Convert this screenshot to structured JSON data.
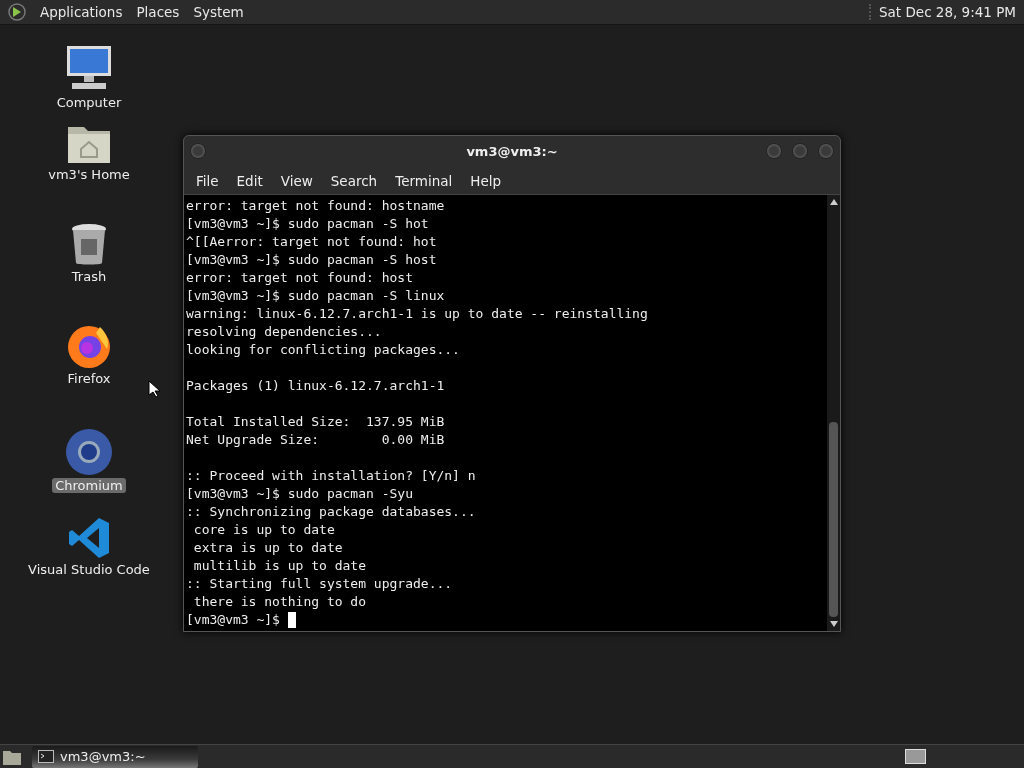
{
  "top_panel": {
    "menus": [
      "Applications",
      "Places",
      "System"
    ],
    "clock": "Sat Dec 28,  9:41 PM"
  },
  "desktop_icons": [
    {
      "kind": "computer",
      "label": "Computer",
      "selected": false
    },
    {
      "kind": "home",
      "label": "vm3's Home",
      "selected": false
    },
    {
      "kind": "trash",
      "label": "Trash",
      "selected": false
    },
    {
      "kind": "firefox",
      "label": "Firefox",
      "selected": false
    },
    {
      "kind": "chromium",
      "label": "Chromium",
      "selected": true
    },
    {
      "kind": "vscode",
      "label": "Visual Studio Code",
      "selected": false
    }
  ],
  "window": {
    "title": "vm3@vm3:~",
    "menu": [
      "File",
      "Edit",
      "View",
      "Search",
      "Terminal",
      "Help"
    ],
    "lines": [
      {
        "kind": "text",
        "text": "error: target not found: hostname"
      },
      {
        "kind": "text",
        "text": "[vm3@vm3 ~]$ sudo pacman -S hot"
      },
      {
        "kind": "text",
        "text": "^[[Aerror: target not found: hot"
      },
      {
        "kind": "text",
        "text": "[vm3@vm3 ~]$ sudo pacman -S host"
      },
      {
        "kind": "text",
        "text": "error: target not found: host"
      },
      {
        "kind": "text",
        "text": "[vm3@vm3 ~]$ sudo pacman -S linux"
      },
      {
        "kind": "text",
        "text": "warning: linux-6.12.7.arch1-1 is up to date -- reinstalling"
      },
      {
        "kind": "text",
        "text": "resolving dependencies..."
      },
      {
        "kind": "text",
        "text": "looking for conflicting packages..."
      },
      {
        "kind": "blank"
      },
      {
        "kind": "text",
        "text": "Packages (1) linux-6.12.7.arch1-1"
      },
      {
        "kind": "blank"
      },
      {
        "kind": "text",
        "text": "Total Installed Size:  137.95 MiB"
      },
      {
        "kind": "text",
        "text": "Net Upgrade Size:        0.00 MiB"
      },
      {
        "kind": "blank"
      },
      {
        "kind": "text",
        "text": ":: Proceed with installation? [Y/n] n"
      },
      {
        "kind": "text",
        "text": "[vm3@vm3 ~]$ sudo pacman -Syu"
      },
      {
        "kind": "text",
        "text": ":: Synchronizing package databases..."
      },
      {
        "kind": "text",
        "text": " core is up to date"
      },
      {
        "kind": "text",
        "text": " extra is up to date"
      },
      {
        "kind": "text",
        "text": " multilib is up to date"
      },
      {
        "kind": "text",
        "text": ":: Starting full system upgrade..."
      },
      {
        "kind": "text",
        "text": " there is nothing to do"
      },
      {
        "kind": "prompt",
        "text": "[vm3@vm3 ~]$ ",
        "cursor": true
      }
    ]
  },
  "taskbar": {
    "tasks": [
      {
        "label": "vm3@vm3:~",
        "selected": false
      }
    ]
  }
}
